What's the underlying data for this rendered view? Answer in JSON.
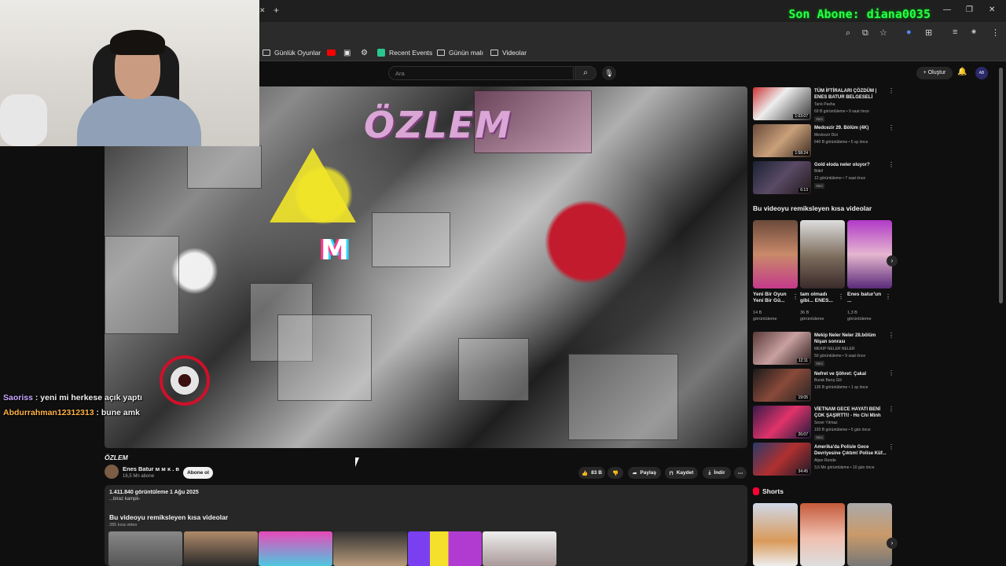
{
  "overlay": {
    "subscriber_banner": "Son Abone: diana0035"
  },
  "bookmarks": [
    {
      "label": "Günlük Oyunlar",
      "icon": "folder-icon"
    },
    {
      "label": "",
      "icon": "youtube-icon"
    },
    {
      "label": "",
      "icon": "image-icon"
    },
    {
      "label": "",
      "icon": "openai-icon"
    },
    {
      "label": "Recent Events",
      "icon": "app-icon"
    },
    {
      "label": "Günün malı",
      "icon": "folder-icon"
    },
    {
      "label": "Videolar",
      "icon": "folder-icon"
    }
  ],
  "header": {
    "search_placeholder": "Ara",
    "create_label": "Oluştur"
  },
  "video": {
    "art_title": "ÖZLEM",
    "art_letters": "M",
    "title": "ÖZLEM",
    "channel": "Enes Batur ᴍ ᴍ ᴋ . ʙ",
    "subscribers": "16,5 Mn abone",
    "subscribe_label": "Abone ol",
    "likes": "83 B",
    "share_label": "Paylaş",
    "save_label": "Kaydet",
    "download_label": "İndir",
    "views_date": "1.411.840 görüntüleme  1 Ağu 2025",
    "description": "...biraz kampk-"
  },
  "chat": [
    {
      "user": "Saoriss",
      "message": " : yeni mi herkese açık yaptı",
      "color": "#c9a8ff"
    },
    {
      "user": "Abdurrahman12312313",
      "message": " : bune amk",
      "color": "#ffb347"
    }
  ],
  "main_remix": {
    "title": "Bu videoyu remiksleyen kısa videolar",
    "count": "285 kısa video"
  },
  "sidebar": {
    "videos_top": [
      {
        "title": "TÜM İFTİRALARI ÇÖZDÜM | ENES BATUR BELGESELİ",
        "channel": "Tarık Pasha",
        "stats": "69 B görüntüleme • 9 saat önce",
        "duration": "1:03:07",
        "badge": "Yeni"
      },
      {
        "title": "Medcezir 29. Bölüm (4K)",
        "channel": "Medcezir Dizi",
        "stats": "640 B görüntüleme • 5 ay önce",
        "duration": "1:58:24",
        "badge": ""
      },
      {
        "title": "Gold eloda neler oluyor?",
        "channel": "Bitkif",
        "stats": "12 görüntüleme • 7 saat önce",
        "duration": "6:13",
        "badge": "Yeni"
      }
    ],
    "remix_title": "Bu videoyu remiksleyen kısa videolar",
    "remix_shorts": [
      {
        "title": "Yeni Bir Oyun Yeni Bir Gü...",
        "views": "14 B görüntüleme"
      },
      {
        "title": "tam olmadı gibi... ENES...",
        "views": "36 B görüntüleme"
      },
      {
        "title": "Enes batur'un ...",
        "views": "1,3 B görüntüleme"
      }
    ],
    "videos_bottom": [
      {
        "title": "Mekip Neler Neler 28.bölüm Nişan sonrası",
        "channel": "MEKIP NELER NELER",
        "stats": "50 görüntüleme • 9 saat önce",
        "duration": "12:11",
        "badge": "Yeni"
      },
      {
        "title": "Nefret ve Şöhret: Çakal",
        "channel": "Burak Barış Gili",
        "stats": "136 B görüntüleme • 1 ay önce",
        "duration": "19:05",
        "badge": ""
      },
      {
        "title": "VİETNAM GECE HAYATI BENİ ÇOK ŞAŞIRTTI! - Ho Chi Minh",
        "channel": "Sezer Yılmaz",
        "stats": "193 B görüntüleme • 5 gün önce",
        "duration": "26:07",
        "badge": "Yeni"
      },
      {
        "title": "Amerika'da Polisle Gece Devriyesine Çıktım! Polise Küf...",
        "channel": "Alper Rende",
        "stats": "3,6 Mn görüntüleme • 10 gün önce",
        "duration": "34:45",
        "badge": ""
      }
    ],
    "shorts_title": "Shorts"
  }
}
